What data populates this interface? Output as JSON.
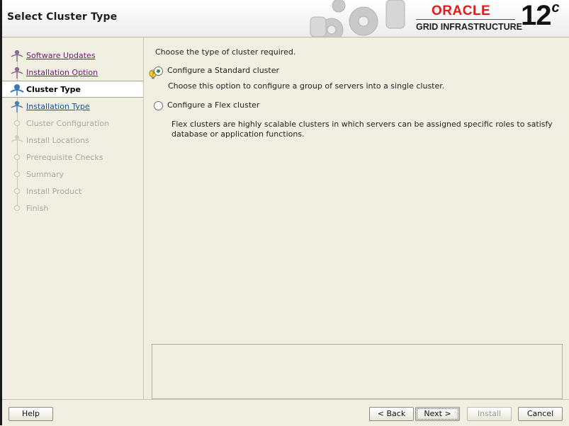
{
  "header": {
    "title": "Select Cluster Type",
    "brand": "ORACLE",
    "product": "GRID INFRASTRUCTURE",
    "version": "12",
    "version_suffix": "c"
  },
  "sidebar": {
    "steps": [
      {
        "label": "Software Updates",
        "state": "done"
      },
      {
        "label": "Installation Option",
        "state": "done"
      },
      {
        "label": "Cluster Type",
        "state": "current"
      },
      {
        "label": "Installation Type",
        "state": "next"
      },
      {
        "label": "Cluster Configuration",
        "state": "pending"
      },
      {
        "label": "Install Locations",
        "state": "pending"
      },
      {
        "label": "Prerequisite Checks",
        "state": "pending"
      },
      {
        "label": "Summary",
        "state": "pending"
      },
      {
        "label": "Install Product",
        "state": "pending"
      },
      {
        "label": "Finish",
        "state": "pending"
      }
    ]
  },
  "main": {
    "prompt": "Choose the type of cluster required.",
    "options": [
      {
        "label": "Configure a Standard cluster",
        "selected": true,
        "description": "Choose this option to configure a group of servers into a single cluster."
      },
      {
        "label": "Configure a Flex cluster",
        "selected": false,
        "description": "Flex clusters are highly scalable clusters in which servers can be assigned specific roles to satisfy database or application functions."
      }
    ],
    "hint_icon": "lightbulb-help-icon"
  },
  "footer": {
    "help": "Help",
    "back": "< Back",
    "next": "Next >",
    "install": "Install",
    "cancel": "Cancel"
  },
  "colors": {
    "brand_red": "#e01b1b",
    "visited_link": "#6a1d6a",
    "next_link": "#15528a",
    "pending_text": "#a9a9a3",
    "selected_radio": "#2f8f33"
  }
}
